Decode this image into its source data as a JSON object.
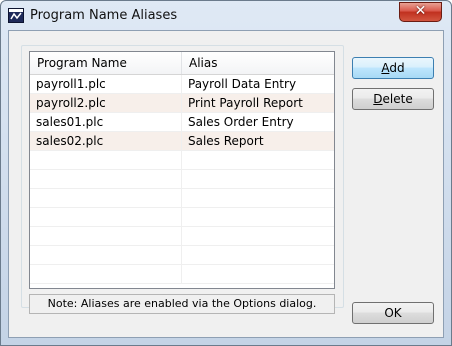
{
  "window": {
    "title": "Program Name Aliases",
    "icon": "app-window-icon",
    "close_label": "✕"
  },
  "list": {
    "columns": [
      "Program Name",
      "Alias"
    ],
    "rows": [
      {
        "program": "payroll1.plc",
        "alias": "Payroll Data Entry"
      },
      {
        "program": "payroll2.plc",
        "alias": "Print Payroll Report"
      },
      {
        "program": "sales01.plc",
        "alias": "Sales Order Entry"
      },
      {
        "program": "sales02.plc",
        "alias": "Sales Report"
      },
      {
        "program": "",
        "alias": ""
      },
      {
        "program": "",
        "alias": ""
      },
      {
        "program": "",
        "alias": ""
      },
      {
        "program": "",
        "alias": ""
      },
      {
        "program": "",
        "alias": ""
      },
      {
        "program": "",
        "alias": ""
      },
      {
        "program": "",
        "alias": ""
      }
    ]
  },
  "note": "Note: Aliases are enabled via the Options dialog.",
  "buttons": {
    "add": {
      "prefix": "",
      "mnemonic": "A",
      "suffix": "dd"
    },
    "delete": {
      "prefix": "",
      "mnemonic": "D",
      "suffix": "elete"
    },
    "ok": "OK"
  },
  "colors": {
    "alt_row": "#f7efea",
    "default_button": "#bee6fd",
    "close_button": "#c0301f"
  }
}
